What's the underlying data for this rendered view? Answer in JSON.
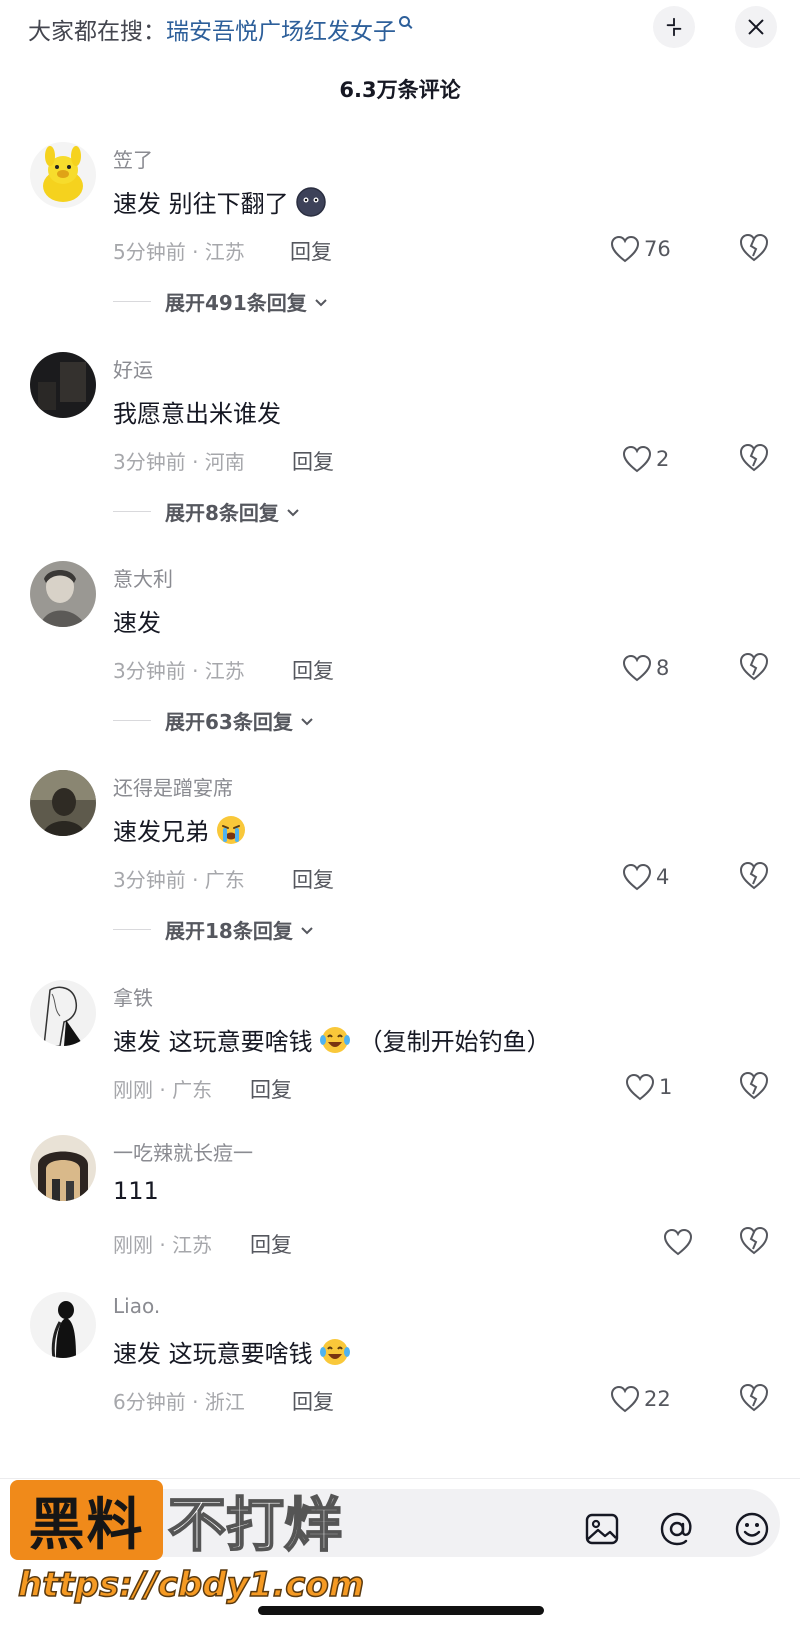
{
  "header": {
    "search_prefix": "大家都在搜：",
    "search_term": "瑞安吾悦广场红发女子",
    "comment_count": "6.3万条评论"
  },
  "comments": [
    {
      "username": "笠了",
      "text": "速发 别往下翻了",
      "text_after": "",
      "emoji": "dark-blob-emoji",
      "time_location": "5分钟前 · 江苏",
      "reply_label": "回复",
      "likes": "76",
      "expand_label": "展开491条回复",
      "avatar": "yellow-toy-dog"
    },
    {
      "username": "好运",
      "text": "我愿意出米谁发",
      "text_after": "",
      "emoji": "",
      "time_location": "3分钟前 · 河南",
      "reply_label": "回复",
      "likes": "2",
      "expand_label": "展开8条回复",
      "avatar": "dark-room"
    },
    {
      "username": "意大利",
      "text": "速发",
      "text_after": "",
      "emoji": "",
      "time_location": "3分钟前 · 江苏",
      "reply_label": "回复",
      "likes": "8",
      "expand_label": "展开63条回复",
      "avatar": "person-portrait"
    },
    {
      "username": "还得是蹭宴席",
      "text": "速发兄弟",
      "text_after": "",
      "emoji": "loudly-crying-emoji",
      "time_location": "3分钟前 · 广东",
      "reply_label": "回复",
      "likes": "4",
      "expand_label": "展开18条回复",
      "avatar": "person-dim"
    },
    {
      "username": "拿铁",
      "text": "速发 这玩意要啥钱",
      "text_after": "（复制开始钓鱼）",
      "emoji": "tears-of-joy-emoji",
      "time_location": "刚刚 · 广东",
      "reply_label": "回复",
      "likes": "1",
      "expand_label": "",
      "avatar": "sketch-figure"
    },
    {
      "username": "一吃辣就长痘一",
      "text": "111",
      "text_after": "",
      "emoji": "",
      "time_location": "刚刚 · 江苏",
      "reply_label": "回复",
      "likes": "",
      "expand_label": "",
      "avatar": "archway-scene"
    },
    {
      "username": "Liao.",
      "text": "速发 这玩意要啥钱",
      "text_after": "",
      "emoji": "tears-of-joy-emoji",
      "time_location": "6分钟前 · 浙江",
      "reply_label": "回复",
      "likes": "22",
      "expand_label": "",
      "avatar": "silhouette"
    }
  ],
  "input_bar": {
    "placeholder": "",
    "icons": [
      "image-icon",
      "at-icon",
      "smile-icon"
    ]
  },
  "watermark": {
    "box_text": "黑料",
    "side_text": "不打烊",
    "url": "https://cbdy1.com"
  },
  "colors": {
    "search_term": "#2d5f9a",
    "watermark_orange": "#f08a1a"
  }
}
